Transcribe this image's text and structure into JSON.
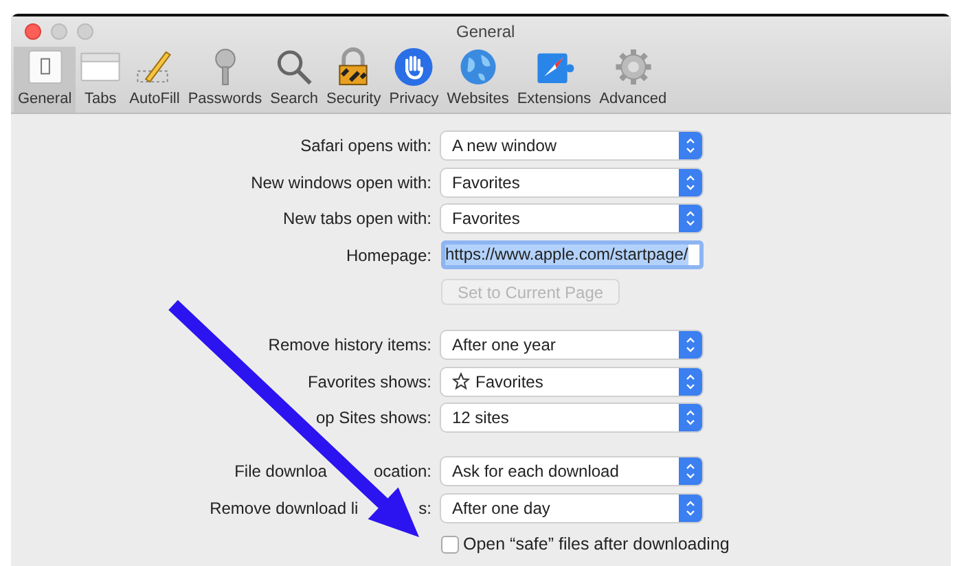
{
  "window": {
    "title": "General"
  },
  "tabs": [
    {
      "label": "General",
      "selected": true
    },
    {
      "label": "Tabs",
      "selected": false
    },
    {
      "label": "AutoFill",
      "selected": false
    },
    {
      "label": "Passwords",
      "selected": false
    },
    {
      "label": "Search",
      "selected": false
    },
    {
      "label": "Security",
      "selected": false
    },
    {
      "label": "Privacy",
      "selected": false
    },
    {
      "label": "Websites",
      "selected": false
    },
    {
      "label": "Extensions",
      "selected": false
    },
    {
      "label": "Advanced",
      "selected": false
    }
  ],
  "sections": [
    {
      "rows": [
        {
          "kind": "popup",
          "label": [
            "Safari opens with:"
          ],
          "value": "A new window"
        },
        {
          "kind": "popup",
          "label": [
            "New windows open with:"
          ],
          "value": "Favorites"
        },
        {
          "kind": "popup",
          "label": [
            "New tabs open with:"
          ],
          "value": "Favorites"
        },
        {
          "kind": "field",
          "label": [
            "Homepage:"
          ],
          "value": "https://www.apple.com/startpage/"
        },
        {
          "kind": "button",
          "label": [],
          "value": "Set to Current Page",
          "disabled": true
        }
      ]
    },
    {
      "rows": [
        {
          "kind": "popup",
          "label": [
            "Remove history items:"
          ],
          "value": "After one year"
        },
        {
          "kind": "popup",
          "label": [
            "Favorites shows:"
          ],
          "value": "Favorites",
          "star": true
        },
        {
          "kind": "popup",
          "label": [
            "op Sites shows:"
          ],
          "value": "12 sites"
        }
      ]
    },
    {
      "rows": [
        {
          "kind": "popup",
          "label": [
            "File downloa",
            "ocation:"
          ],
          "value": "Ask for each download"
        },
        {
          "kind": "popup",
          "label": [
            "Remove download li",
            "s:"
          ],
          "value": "After one day"
        },
        {
          "kind": "checkbox",
          "label": [],
          "value": "Open “safe” files after downloading",
          "checked": false
        }
      ]
    }
  ]
}
